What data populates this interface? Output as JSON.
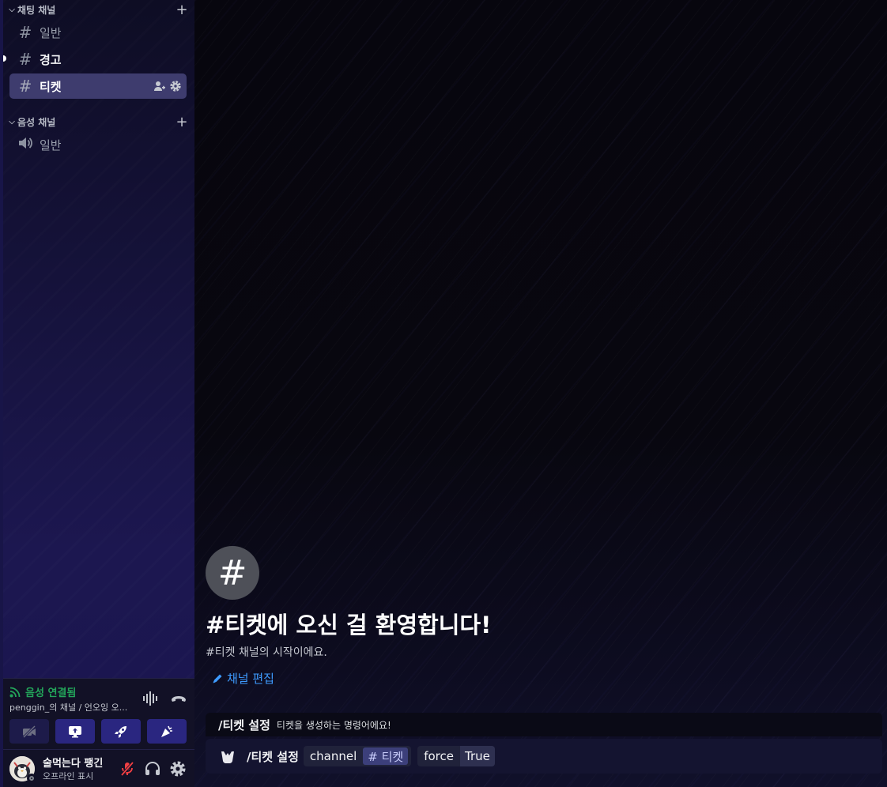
{
  "sidebar": {
    "text_category": {
      "label": "채팅 채널",
      "add": "+",
      "chevron": "⌵"
    },
    "text_channels": [
      {
        "name": "일반",
        "glyph": "#",
        "state": "normal"
      },
      {
        "name": "경고",
        "glyph": "#",
        "state": "unread"
      },
      {
        "name": "티켓",
        "glyph": "#",
        "state": "selected"
      }
    ],
    "voice_category": {
      "label": "음성 채널",
      "add": "+",
      "chevron": "⌵"
    },
    "voice_channels": [
      {
        "name": "일반",
        "glyph": "speaker-icon"
      }
    ]
  },
  "voice_panel": {
    "status": "음성 연결됨",
    "subtitle": "penggin_의 채널 / 언오잉 오...",
    "status_color": "#23a55a",
    "buttons": [
      "camera-off-icon",
      "screen-share-icon",
      "activity-rocket-icon",
      "soundboard-icon"
    ]
  },
  "user_panel": {
    "name": "술먹는다 팽긴",
    "status": "오프라인 표시",
    "icons": [
      "mic-muted-icon",
      "headphones-icon",
      "gear-icon"
    ]
  },
  "main": {
    "welcome_glyph": "#",
    "welcome_title": "#티켓에 오신 걸 환영합니다!",
    "welcome_sub": "#티켓 채널의 시작이에요.",
    "edit_link": "채널 편집",
    "accent": "#3e9bff"
  },
  "command_popup": {
    "command": "/티켓 설정",
    "description": "티켓을 생성하는 명령어에요!"
  },
  "composer": {
    "command": "/티켓 설정",
    "options": [
      {
        "key": "channel",
        "value": "# 티켓"
      },
      {
        "key": "force",
        "value": "True"
      }
    ]
  }
}
